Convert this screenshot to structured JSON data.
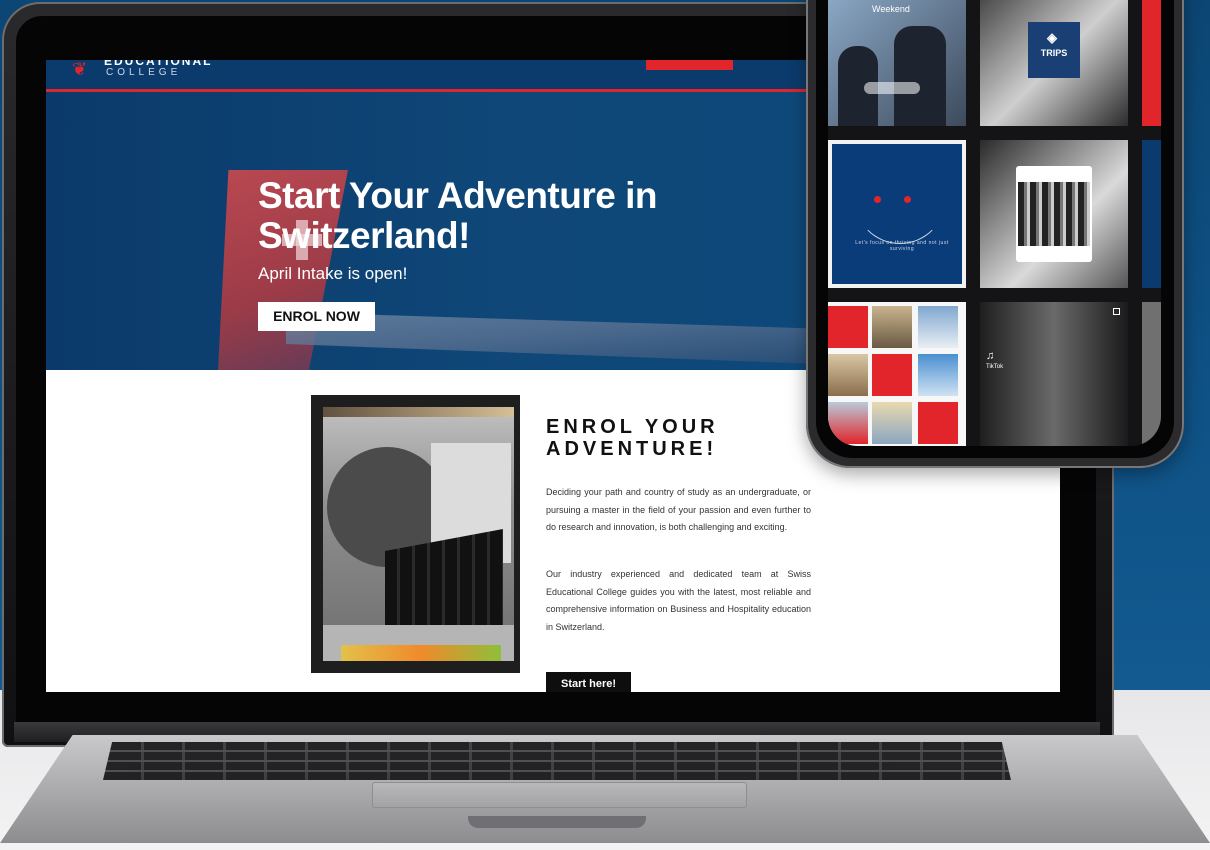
{
  "site": {
    "logo": {
      "line1": "EDUCATIONAL",
      "line2": "COLLEGE"
    }
  },
  "hero": {
    "title": "Start Your Adventure in Switzerland!",
    "subtitle": "April Intake is open!",
    "cta": "ENROL NOW"
  },
  "content": {
    "heading": "ENROL YOUR ADVENTURE!",
    "paragraph1": "Deciding your path and country of study as an undergraduate, or pursuing a master in the field of your passion and even further to do research and innovation, is both challenging and exciting.",
    "paragraph2": "Our industry experienced and dedicated team at Swiss Educational College guides you with the latest, most reliable and comprehensive information on Business and Hospitality education in Switzerland.",
    "cta": "Start here!"
  },
  "phone": {
    "tile1_text": "Weekend",
    "tile2_badge": "TRIPS",
    "tile4_text": "Let's focus on thriving and not just surviving",
    "tile8_label": "TikTok"
  },
  "colors": {
    "brand_blue": "#0b3b6c",
    "brand_red": "#e1252a"
  },
  "icons": [
    "lion-logo-icon",
    "shield-icon",
    "tiktok-icon",
    "smiley-icon"
  ]
}
